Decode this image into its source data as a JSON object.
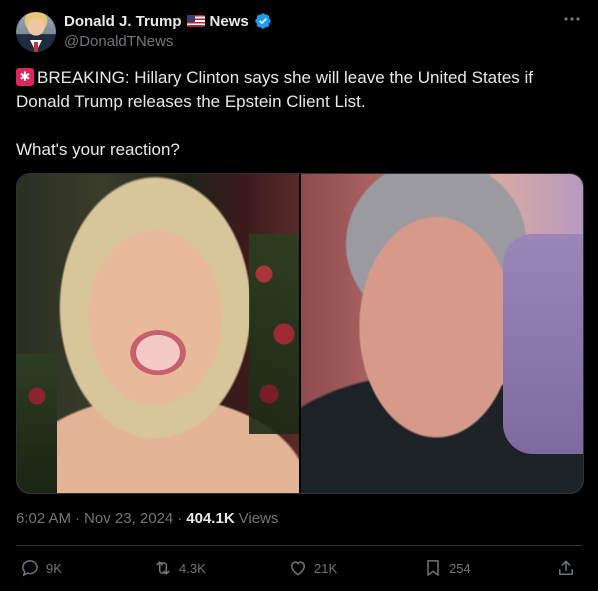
{
  "author": {
    "name": "Donald J. Trump",
    "name_suffix": "News",
    "handle": "@DonaldTNews"
  },
  "tweet": {
    "line1": "BREAKING: Hillary Clinton says she will leave the United States if Donald Trump releases the Epstein Client List.",
    "line2": "What's your reaction?"
  },
  "media": {
    "left_image": "portrait-woman-smiling",
    "right_image": "portrait-man-gray-hair"
  },
  "meta": {
    "time": "6:02 AM",
    "dot1": "·",
    "date": "Nov 23, 2024",
    "dot2": "·",
    "views_count": "404.1K",
    "views_label": "Views"
  },
  "actions": {
    "replies": "9K",
    "reposts": "4.3K",
    "likes": "21K",
    "bookmarks": "254"
  },
  "colors": {
    "background": "#000000",
    "text": "#e7e9ea",
    "muted": "#71767b",
    "verified": "#1d9bf0",
    "siren": "#e0245e",
    "border": "#2f3336"
  }
}
